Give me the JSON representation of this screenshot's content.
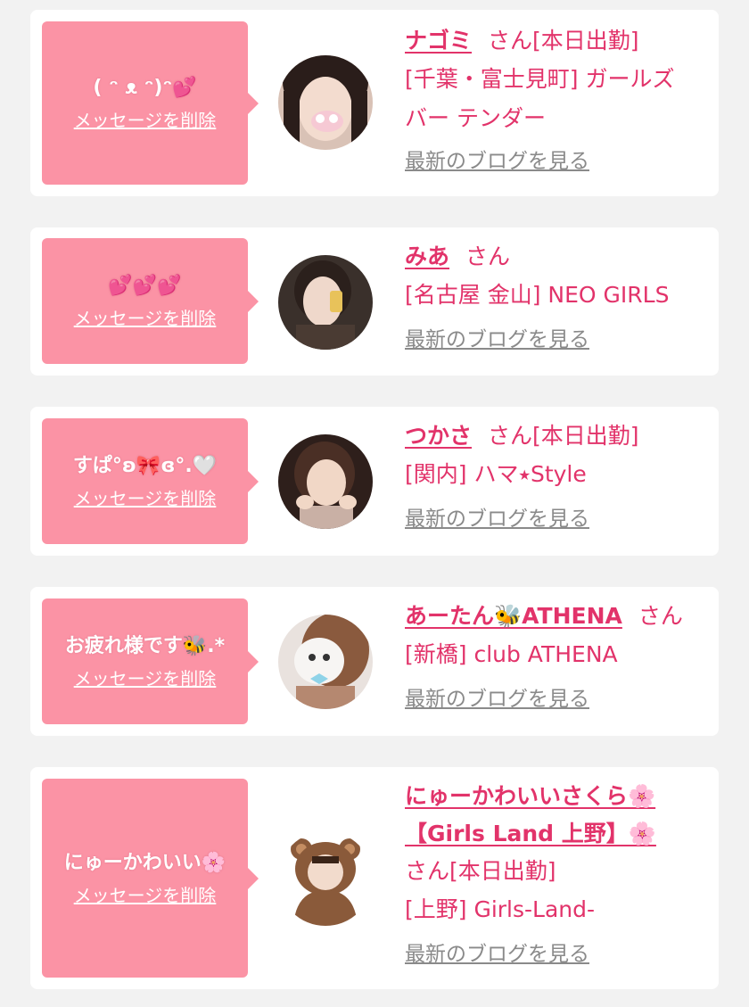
{
  "entries": [
    {
      "message": "( ᵔ ᴥ ᵔ)ᵔ💕",
      "delete_label": "メッセージを削除",
      "name": "ナゴミ",
      "honorific": "さん",
      "status": "[本日出勤]",
      "location_line1": "[千葉・富士見町] ガールズ",
      "location_line2": "バー テンダー",
      "blog_label": "最新のブログを見る"
    },
    {
      "message": "💕💕💕",
      "delete_label": "メッセージを削除",
      "name": "みあ",
      "honorific": "さん",
      "location_line1": "[名古屋 金山] NEO GIRLS",
      "blog_label": "最新のブログを見る"
    },
    {
      "message": "すぱ°ʚ🎀ɞ°.🤍",
      "delete_label": "メッセージを削除",
      "name": "つかさ",
      "honorific": "さん",
      "status": "[本日出勤]",
      "location_line1": "[関内] ハマ⭑Style",
      "blog_label": "最新のブログを見る"
    },
    {
      "message": "お疲れ様です🐝.*",
      "delete_label": "メッセージを削除",
      "name": "あーたん🐝ATHENA",
      "honorific": "さん",
      "location_line1": "[新橋] club ATHENA",
      "blog_label": "最新のブログを見る"
    },
    {
      "message": "にゅーかわいい🌸",
      "delete_label": "メッセージを削除",
      "name_line1": "にゅーかわいいさくら🌸",
      "name_line2": "【Girls Land 上野】🌸",
      "honorific": "さん",
      "status": "[本日出勤]",
      "location_line1": "[上野] Girls-Land-",
      "blog_label": "最新のブログを見る"
    }
  ],
  "colors": {
    "accent": "#e2336a",
    "bubble": "#fb93a5",
    "link_gray": "#8a8a8a",
    "background": "#f2f2f2"
  }
}
